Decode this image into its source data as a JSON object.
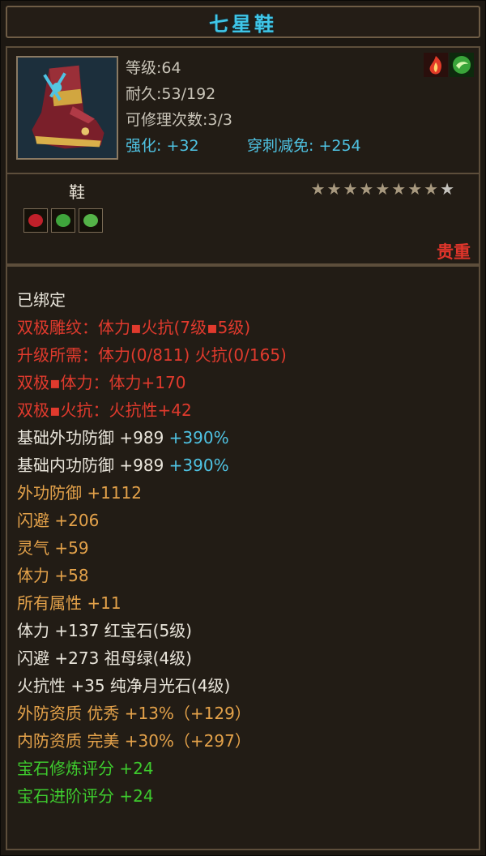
{
  "title": "七星鞋",
  "info": {
    "level": "等级:64",
    "durability": "耐久:53/192",
    "repair": "可修理次数:3/3",
    "enhance": "强化: +32",
    "pierce": "穿刺减免: +254"
  },
  "item_type": "鞋",
  "stars": {
    "filled": 8,
    "total": 9
  },
  "gem_colors": [
    "#c0202a",
    "#3fa53c",
    "#54b348"
  ],
  "rarity": "贵重",
  "colors": {
    "title": "#3fc6e8",
    "red": "#e03a2d",
    "orange": "#e4a24a",
    "green": "#3ecb2e",
    "cyan": "#4fc3e3"
  },
  "attributes": {
    "bound": "已绑定",
    "line1": "双极雕纹：体力▪火抗(7级▪5级)",
    "line2": "升级所需：体力(0/811)  火抗(0/165)",
    "line3": "双极▪体力：体力+170",
    "line4": "双极▪火抗：火抗性+42",
    "line5a": "基础外功防御 +989 ",
    "line5b": "+390%",
    "line6a": "基础内功防御 +989 ",
    "line6b": "+390%",
    "line7": "外功防御 +1112",
    "line8": "闪避 +206",
    "line9": "灵气 +59",
    "line10": "体力 +58",
    "line11": "所有属性 +11",
    "line12": "体力 +137 红宝石(5级)",
    "line13": "闪避 +273 祖母绿(4级)",
    "line14": "火抗性 +35 纯净月光石(4级)",
    "line15": "外防资质  优秀 +13%（+129）",
    "line16": "内防资质  完美 +30%（+297）",
    "line17": "宝石修炼评分 +24",
    "line18": "宝石进阶评分 +24"
  }
}
